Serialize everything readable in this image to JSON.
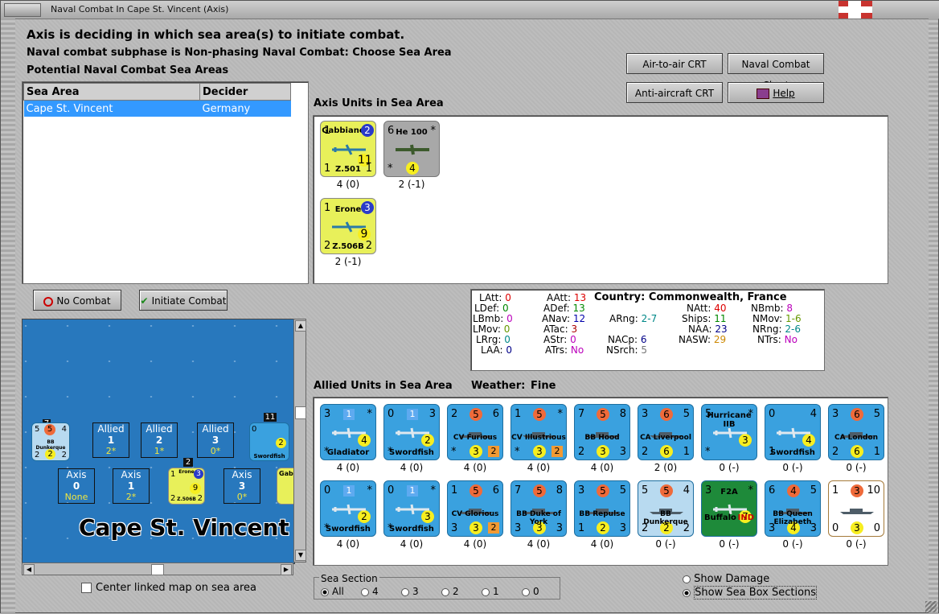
{
  "window": {
    "title": "Naval Combat In Cape St. Vincent (Axis)"
  },
  "header": {
    "line1": "Axis is deciding in which sea area(s) to initiate combat.",
    "line2": "Naval combat subphase is Non-phasing Naval Combat: Choose Sea Area",
    "line3": "Potential Naval Combat Sea Areas"
  },
  "buttons": {
    "air_to_air": "Air-to-air CRT",
    "naval_chart": "Naval Combat Chart",
    "anti_aircraft": "Anti-aircraft CRT",
    "help": "Help",
    "no_combat": "No Combat",
    "initiate": "Initiate Combat"
  },
  "sea_table": {
    "headers": [
      "Sea Area",
      "Decider"
    ],
    "rows": [
      [
        "Cape St. Vincent",
        "Germany"
      ]
    ]
  },
  "axis_label": "Axis Units in Sea Area",
  "allied_label": "Allied Units in Sea Area",
  "weather_label": "Weather:",
  "weather_value": "Fine",
  "axis_units": [
    {
      "name": "Gabbiano",
      "model": "Z.501",
      "tl": "1",
      "circle": "2",
      "big": "11",
      "bl": "1",
      "br": "1",
      "label": "4 (0)"
    },
    {
      "name": "He 100",
      "tl": "6",
      "tr": "*",
      "circle": "4",
      "bl": "*",
      "label": "2 (-1)"
    },
    {
      "name": "Erone",
      "model": "Z.506B",
      "tl": "1",
      "circle": "3",
      "big": "9",
      "bl": "2",
      "br": "2",
      "label": "2 (-1)"
    }
  ],
  "stats": {
    "country_label": "Country:",
    "country": "Commonwealth, France",
    "col1": [
      [
        "LAtt:",
        "0"
      ],
      [
        "LDef:",
        "0"
      ],
      [
        "LBmb:",
        "0"
      ],
      [
        "LMov:",
        "0"
      ],
      [
        "LRrg:",
        "0"
      ],
      [
        "LAA:",
        "0"
      ]
    ],
    "col2": [
      [
        "AAtt:",
        "13"
      ],
      [
        "ADef:",
        "13"
      ],
      [
        "ANav:",
        "12"
      ],
      [
        "ATac:",
        "3"
      ],
      [
        "AStr:",
        "0"
      ],
      [
        "ATrs:",
        "No"
      ]
    ],
    "col3": [
      [
        "ARng:",
        "2-7"
      ],
      [
        "NACp:",
        "6"
      ],
      [
        "NSrch:",
        "5"
      ]
    ],
    "col4": [
      [
        "NAtt:",
        "40"
      ],
      [
        "Ships:",
        "11"
      ],
      [
        "NAA:",
        "23"
      ],
      [
        "NASW:",
        "29"
      ]
    ],
    "col5": [
      [
        "NBmb:",
        "8"
      ],
      [
        "NMov:",
        "1-6"
      ],
      [
        "NRng:",
        "2-6"
      ],
      [
        "NTrs:",
        "No"
      ]
    ]
  },
  "allied_units": [
    {
      "tl": "3",
      "sq": "1",
      "tr": "*",
      "name": "Gladiator",
      "bl": "*",
      "yc": "4",
      "label": "4 (0)",
      "type": "plane"
    },
    {
      "tl": "0",
      "sq": "1",
      "tr": "3",
      "name": "Swordfish",
      "bl": "*",
      "yc": "2",
      "label": "4 (0)",
      "type": "plane"
    },
    {
      "tl": "2",
      "oc": "5",
      "tr": "6",
      "name": "CV Furious",
      "bl": "*",
      "yc": "3",
      "orsq": "2",
      "label": "4 (0)",
      "type": "ship"
    },
    {
      "tl": "1",
      "oc": "5",
      "tr": "*",
      "name": "CV Illustrious",
      "bl": "*",
      "yc": "3",
      "orsq": "2",
      "label": "4 (0)",
      "type": "ship"
    },
    {
      "tl": "7",
      "oc": "5",
      "tr": "8",
      "name": "BB Hood",
      "bl": "2",
      "yc": "3",
      "br": "3",
      "label": "4 (0)",
      "type": "ship"
    },
    {
      "tl": "3",
      "oc": "6",
      "tr": "5",
      "name": "CA Liverpool",
      "bl": "2",
      "yc": "6",
      "br": "1",
      "label": "2 (0)",
      "type": "ship"
    },
    {
      "tl": "5",
      "name": "Hurricane IIB",
      "tr": "*",
      "bl": "*",
      "yc": "3",
      "label": "0 (-)",
      "type": "plane"
    },
    {
      "tl": "0",
      "tr": "4",
      "name": "Swordfish",
      "bl": "1",
      "yc": "4",
      "label": "0 (-)",
      "type": "plane"
    },
    {
      "tl": "3",
      "oc": "6",
      "tr": "5",
      "name": "CA London",
      "bl": "2",
      "yc": "6",
      "br": "1",
      "label": "0 (-)",
      "type": "ship"
    },
    {
      "tl": "0",
      "sq": "1",
      "tr": "*",
      "name": "Swordfish",
      "bl": "*",
      "yc": "2",
      "label": "4 (0)",
      "type": "plane"
    },
    {
      "tl": "0",
      "sq": "1",
      "tr": "*",
      "name": "Swordfish",
      "bl": "*",
      "yc": "3",
      "label": "4 (0)",
      "type": "plane"
    },
    {
      "tl": "1",
      "oc": "5",
      "tr": "6",
      "name": "CV Glorious",
      "bl": "3",
      "yc": "3",
      "orsq": "2",
      "label": "4 (0)",
      "type": "ship"
    },
    {
      "tl": "7",
      "oc": "5",
      "tr": "8",
      "name": "BB Duke of York",
      "bl": "3",
      "yc": "3",
      "br": "3",
      "label": "4 (0)",
      "type": "ship"
    },
    {
      "tl": "3",
      "oc": "5",
      "tr": "5",
      "name": "BB Repulse",
      "bl": "1",
      "yc": "2",
      "br": "3",
      "label": "4 (0)",
      "type": "ship"
    },
    {
      "tl": "5",
      "oc": "5",
      "tr": "4",
      "name": "BB Dunkerque",
      "bl": "2",
      "yc": "2",
      "br": "2",
      "label": "0 (-)",
      "type": "ship",
      "light": true
    },
    {
      "tl": "3",
      "name": "F2A",
      "tr": "*",
      "extra": "Buffalo",
      "ind": "IND",
      "yc": "7",
      "label": "0 (-)",
      "type": "plane"
    },
    {
      "tl": "6",
      "oc": "4",
      "tr": "5",
      "name": "BB Queen Elizabeth",
      "bl": "3",
      "yc": "4",
      "br": "3",
      "label": "0 (-)",
      "type": "ship"
    },
    {
      "tl": "1",
      "oc": "3",
      "tr": "10",
      "bl": "0",
      "yc": "3",
      "br": "0",
      "label": "0 (-)",
      "type": "ship",
      "white": true
    }
  ],
  "map": {
    "sea_name": "Cape St. Vincent",
    "dunk_stack": "7",
    "dunk_tl": "5",
    "dunk_c": "5",
    "dunk_tr": "4",
    "dunk_name": "BB Dunkerque",
    "dunk_bl": "2",
    "dunk_yc": "2",
    "dunk_br": "2",
    "sword_stack": "11",
    "sword_name": "Swordfish",
    "sword_tl": "0",
    "sword_c": "2",
    "erone_stack": "2",
    "erone_name": "Erone",
    "erone_model": "Z.506B",
    "erone_c": "3",
    "erone_big": "9",
    "erone_tl": "1",
    "erone_bl": "2",
    "erone_br": "2",
    "gab": "Gab",
    "boxes": [
      {
        "side": "Allied",
        "val": "1",
        "sub": "2*"
      },
      {
        "side": "Allied",
        "val": "2",
        "sub": "1*"
      },
      {
        "side": "Allied",
        "val": "3",
        "sub": "0*"
      },
      {
        "side": "Axis",
        "val": "0",
        "sub": "None"
      },
      {
        "side": "Axis",
        "val": "1",
        "sub": "2*"
      },
      {
        "side": "Axis",
        "val": "3",
        "sub": "0*"
      }
    ]
  },
  "center_map_label": "Center linked map on sea area",
  "sea_section": {
    "label": "Sea Section",
    "options": [
      "All",
      "4",
      "3",
      "2",
      "1",
      "0"
    ]
  },
  "show_damage": "Show Damage",
  "show_sections": "Show Sea Box Sections"
}
